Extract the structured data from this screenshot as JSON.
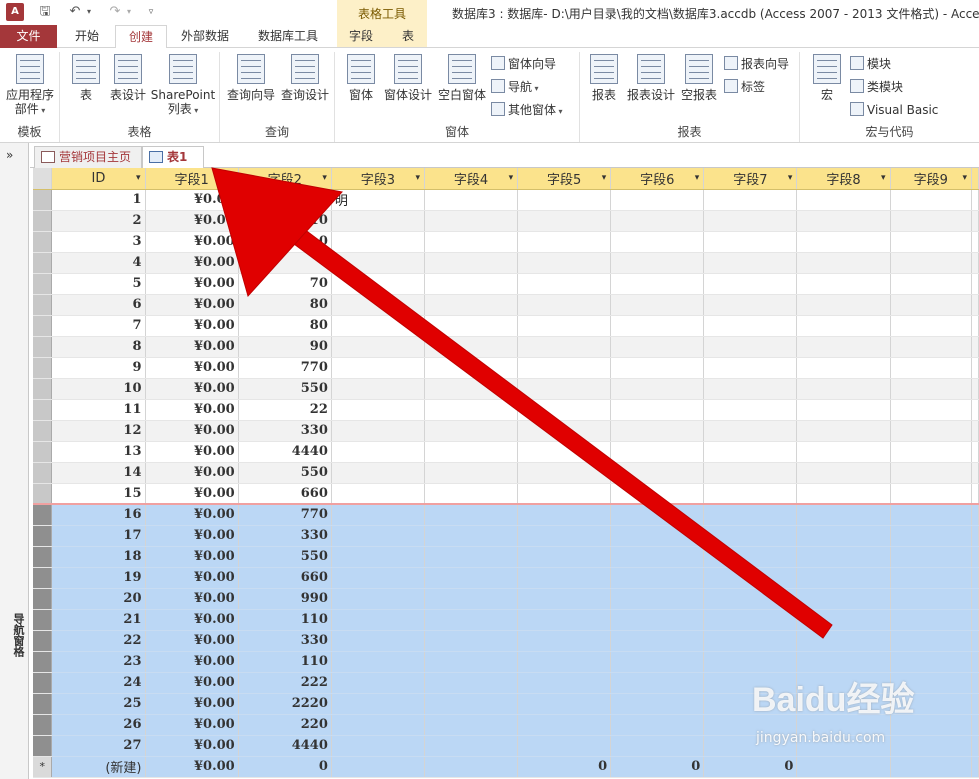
{
  "titlebar": {
    "app_icon_text": "A",
    "window_title": "数据库3 : 数据库- D:\\用户目录\\我的文档\\数据库3.accdb (Access 2007 - 2013 文件格式) - Access",
    "context_group": "表格工具"
  },
  "ribbon_tabs": {
    "file": "文件",
    "home": "开始",
    "create": "创建",
    "external": "外部数据",
    "dbtools": "数据库工具",
    "fields": "字段",
    "table": "表"
  },
  "ribbon": {
    "templates": {
      "label": "模板",
      "app_parts_1": "应用程序",
      "app_parts_2": "部件"
    },
    "tables": {
      "label": "表格",
      "table": "表",
      "table_design": "表设计",
      "sharepoint_1": "SharePoint",
      "sharepoint_2": "列表"
    },
    "queries": {
      "label": "查询",
      "wizard": "查询向导",
      "design": "查询设计"
    },
    "forms": {
      "label": "窗体",
      "form": "窗体",
      "form_design": "窗体设计",
      "blank_form": "空白窗体",
      "form_wizard": "窗体向导",
      "navigation": "导航",
      "more_forms": "其他窗体"
    },
    "reports": {
      "label": "报表",
      "report": "报表",
      "report_design": "报表设计",
      "blank_report": "空报表",
      "report_wizard": "报表向导",
      "labels": "标签"
    },
    "macros": {
      "label": "宏与代码",
      "macro": "宏",
      "module": "模块",
      "class_module": "类模块",
      "vba": "Visual Basic"
    }
  },
  "nav_pane": {
    "toggle": "»",
    "label": "导航窗格"
  },
  "doc_tabs": {
    "form_tab": "营销项目主页",
    "table_tab": "表1"
  },
  "datasheet": {
    "columns": [
      "ID",
      "字段1",
      "字段2",
      "字段3",
      "字段4",
      "字段5",
      "字段6",
      "字段7",
      "字段8",
      "字段9"
    ],
    "rows": [
      {
        "id": "1",
        "f1": "¥0.00",
        "f2": "12",
        "f3": "明"
      },
      {
        "id": "2",
        "f1": "¥0.00",
        "f2": "10",
        "f3": ""
      },
      {
        "id": "3",
        "f1": "¥0.00",
        "f2": "0",
        "f3": ""
      },
      {
        "id": "4",
        "f1": "¥0.00",
        "f2": "",
        "f3": ""
      },
      {
        "id": "5",
        "f1": "¥0.00",
        "f2": "70",
        "f3": ""
      },
      {
        "id": "6",
        "f1": "¥0.00",
        "f2": "80",
        "f3": ""
      },
      {
        "id": "7",
        "f1": "¥0.00",
        "f2": "80",
        "f3": ""
      },
      {
        "id": "8",
        "f1": "¥0.00",
        "f2": "90",
        "f3": ""
      },
      {
        "id": "9",
        "f1": "¥0.00",
        "f2": "770",
        "f3": ""
      },
      {
        "id": "10",
        "f1": "¥0.00",
        "f2": "550",
        "f3": ""
      },
      {
        "id": "11",
        "f1": "¥0.00",
        "f2": "22",
        "f3": ""
      },
      {
        "id": "12",
        "f1": "¥0.00",
        "f2": "330",
        "f3": ""
      },
      {
        "id": "13",
        "f1": "¥0.00",
        "f2": "4440",
        "f3": ""
      },
      {
        "id": "14",
        "f1": "¥0.00",
        "f2": "550",
        "f3": ""
      },
      {
        "id": "15",
        "f1": "¥0.00",
        "f2": "660",
        "f3": ""
      },
      {
        "id": "16",
        "f1": "¥0.00",
        "f2": "770",
        "f3": ""
      },
      {
        "id": "17",
        "f1": "¥0.00",
        "f2": "330",
        "f3": ""
      },
      {
        "id": "18",
        "f1": "¥0.00",
        "f2": "550",
        "f3": ""
      },
      {
        "id": "19",
        "f1": "¥0.00",
        "f2": "660",
        "f3": ""
      },
      {
        "id": "20",
        "f1": "¥0.00",
        "f2": "990",
        "f3": ""
      },
      {
        "id": "21",
        "f1": "¥0.00",
        "f2": "110",
        "f3": ""
      },
      {
        "id": "22",
        "f1": "¥0.00",
        "f2": "330",
        "f3": ""
      },
      {
        "id": "23",
        "f1": "¥0.00",
        "f2": "110",
        "f3": ""
      },
      {
        "id": "24",
        "f1": "¥0.00",
        "f2": "222",
        "f3": ""
      },
      {
        "id": "25",
        "f1": "¥0.00",
        "f2": "2220",
        "f3": ""
      },
      {
        "id": "26",
        "f1": "¥0.00",
        "f2": "220",
        "f3": ""
      },
      {
        "id": "27",
        "f1": "¥0.00",
        "f2": "4440",
        "f3": ""
      }
    ],
    "highlight_from_id": 16,
    "new_row": {
      "marker": "*",
      "id": "(新建)",
      "f1": "¥0.00",
      "f2": "0",
      "f5": "0",
      "f6": "0",
      "f7": "0"
    }
  },
  "colors": {
    "accent": "#a4373a",
    "header_bg": "#fbe38c",
    "selection_bg": "#bbd7f5",
    "arrow": "#e00000"
  },
  "watermark": {
    "logo": "Baidu经验",
    "url": "jingyan.baidu.com"
  }
}
